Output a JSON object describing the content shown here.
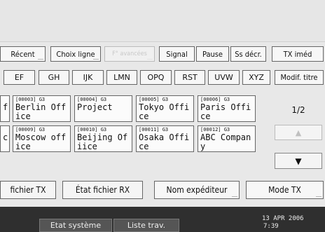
{
  "function_row": {
    "recent": "Récent",
    "choice_line": "Choix ligne",
    "advanced": "F° avancées",
    "signal": "Signal",
    "pause": "Pause",
    "ss_decr": "Ss décr.",
    "tx_immed": "TX iméd"
  },
  "alpha_tabs": [
    "EF",
    "GH",
    "IJK",
    "LMN",
    "OPQ",
    "RST",
    "UVW",
    "XYZ"
  ],
  "modif_title": "Modif. titre",
  "destinations": [
    {
      "code": "",
      "line1": "f",
      "line2": ""
    },
    {
      "code": "[00003] G3",
      "line1": "Berlin Off",
      "line2": "ice"
    },
    {
      "code": "[00004] G3",
      "line1": "Project",
      "line2": ""
    },
    {
      "code": "[00005] G3",
      "line1": "Tokyo Offi",
      "line2": "ce"
    },
    {
      "code": "[00006] G3",
      "line1": "Paris Offi",
      "line2": "ce"
    },
    {
      "code": "",
      "line1": "c",
      "line2": ""
    },
    {
      "code": "[00009] G3",
      "line1": "Moscow off",
      "line2": "ice"
    },
    {
      "code": "[00010] G3",
      "line1": "Beijing Of",
      "line2": "iice"
    },
    {
      "code": "[00011] G3",
      "line1": "Osaka Offi",
      "line2": "ce"
    },
    {
      "code": "[00012] G3",
      "line1": "ABC Compan",
      "line2": "y"
    }
  ],
  "pager": {
    "label": "1/2",
    "up": "▲",
    "down": "▼"
  },
  "bottom_tabs": {
    "tx_file": "fichier TX",
    "rx_file_state": "État fichier RX",
    "sender_name": "Nom expéditeur",
    "tx_mode": "Mode TX"
  },
  "status": {
    "system_state": "Etat système",
    "job_list": "Liste trav.",
    "date": "13 APR  2006",
    "time": "7:39"
  }
}
